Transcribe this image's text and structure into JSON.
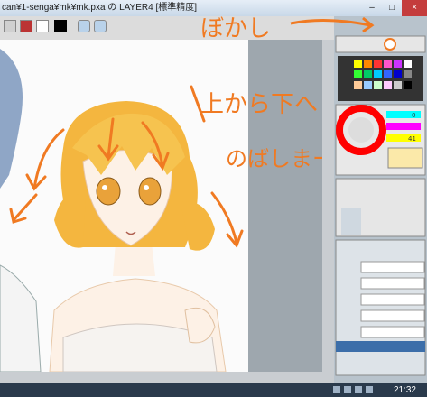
{
  "window": {
    "title": "can¥1-senga¥mk¥mk.pxa の LAYER4 [標準精度]",
    "minimize": "–",
    "maximize": "□",
    "close": "×"
  },
  "annotations": {
    "bokashi": "ぼかし",
    "line1": "上から下へ",
    "line2": "のばしまーす"
  },
  "right_panel": {
    "values": [
      "0",
      "41"
    ]
  },
  "taskbar": {
    "clock": "21:32"
  },
  "colors": {
    "annotation": "#f07a22",
    "hair": "#f4b63f",
    "skin": "#fdf1e6",
    "canvas_bg": "#9ea7ae"
  }
}
